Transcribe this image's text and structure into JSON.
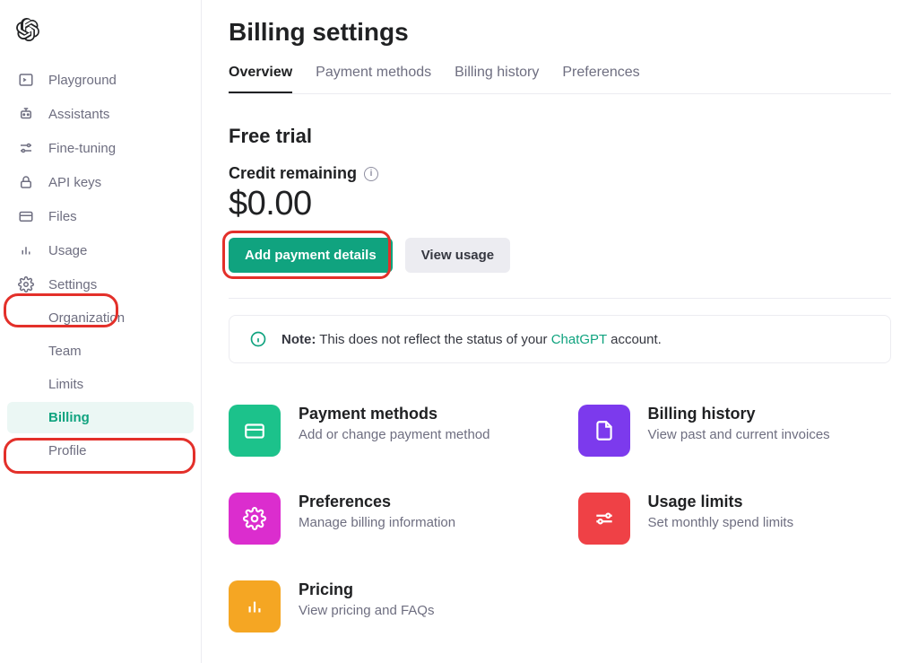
{
  "sidebar": {
    "items": [
      {
        "label": "Playground"
      },
      {
        "label": "Assistants"
      },
      {
        "label": "Fine-tuning"
      },
      {
        "label": "API keys"
      },
      {
        "label": "Files"
      },
      {
        "label": "Usage"
      },
      {
        "label": "Settings"
      }
    ],
    "subitems": [
      {
        "label": "Organization"
      },
      {
        "label": "Team"
      },
      {
        "label": "Limits"
      },
      {
        "label": "Billing"
      },
      {
        "label": "Profile"
      }
    ]
  },
  "page": {
    "title": "Billing settings",
    "tabs": [
      {
        "label": "Overview"
      },
      {
        "label": "Payment methods"
      },
      {
        "label": "Billing history"
      },
      {
        "label": "Preferences"
      }
    ],
    "section_title": "Free trial",
    "credit_label": "Credit remaining",
    "amount": "$0.00",
    "add_button": "Add payment details",
    "view_usage_button": "View usage",
    "note_prefix": "Note:",
    "note_body": " This does not reflect the status of your ",
    "note_link": "ChatGPT",
    "note_suffix": " account."
  },
  "cards": [
    {
      "title": "Payment methods",
      "desc": "Add or change payment method"
    },
    {
      "title": "Billing history",
      "desc": "View past and current invoices"
    },
    {
      "title": "Preferences",
      "desc": "Manage billing information"
    },
    {
      "title": "Usage limits",
      "desc": "Set monthly spend limits"
    },
    {
      "title": "Pricing",
      "desc": "View pricing and FAQs"
    }
  ]
}
